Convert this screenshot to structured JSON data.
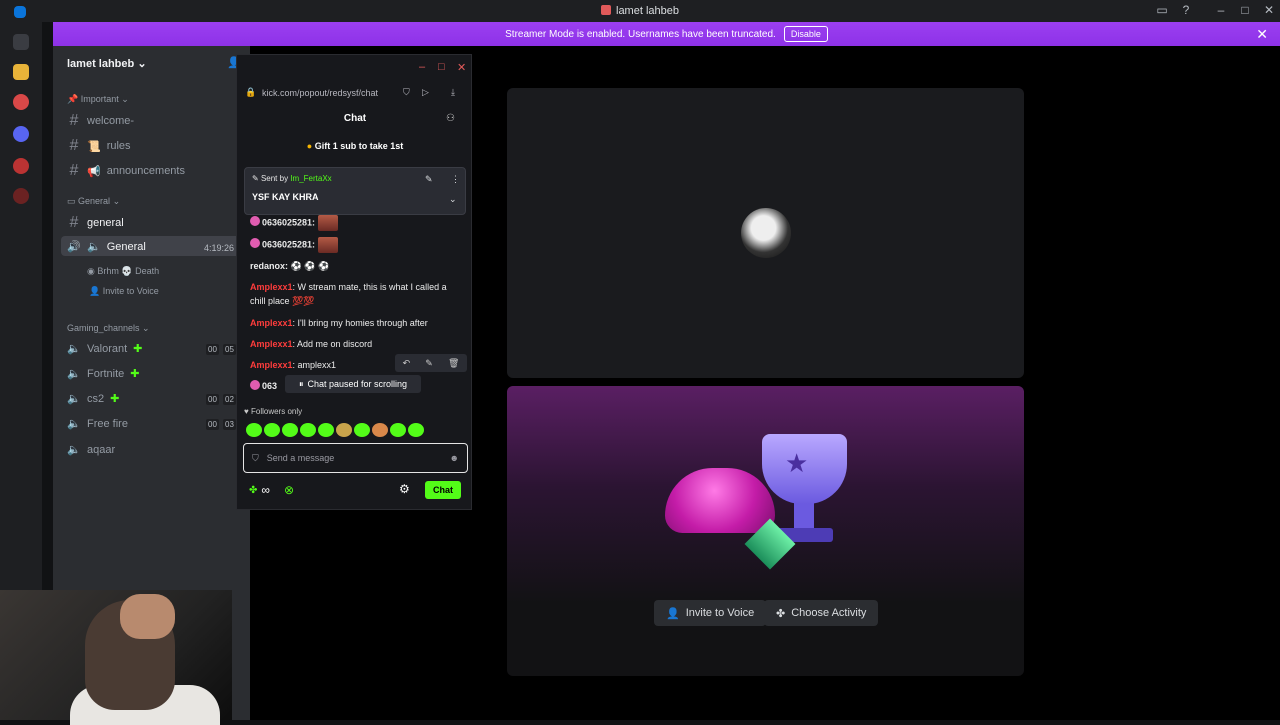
{
  "window": {
    "title": "lamet lahbeb"
  },
  "streamer_banner": {
    "text": "Streamer Mode is enabled. Usernames have been truncated.",
    "button": "Disable"
  },
  "sidebar": {
    "server_name": "lamet lahbeb",
    "categories": {
      "important": "Important",
      "general": "General",
      "gaming": "Gaming_channels"
    },
    "channels": {
      "welcome": "welcome-",
      "rules": "rules",
      "announcements": "announcements",
      "general_text": "general",
      "general_voice": "General",
      "general_voice_time": "4:19:26",
      "voice_user": "Brhm",
      "voice_user_status": "Death",
      "invite": "Invite to Voice",
      "valorant": "Valorant",
      "valorant_stamp_a": "00",
      "valorant_stamp_b": "05",
      "fortnite": "Fortnite",
      "cs2": "cs2",
      "cs2_stamp_a": "00",
      "cs2_stamp_b": "02",
      "freefire": "Free fire",
      "freefire_stamp_a": "00",
      "freefire_stamp_b": "03",
      "aqaar": "aqaar"
    }
  },
  "popup": {
    "url": "kick.com/popout/redsysf/chat",
    "header": "Chat",
    "gift": "Gift 1 sub to take 1st",
    "pinned": {
      "sent_by_label": "Sent by",
      "sent_by_user": "Im_FertaXx",
      "message": "YSF KAY KHRA"
    },
    "messages": [
      {
        "user": "0636025281:",
        "text": ""
      },
      {
        "user": "0636025281:",
        "text": ""
      },
      {
        "user": "redanox:",
        "text": "⚽ ⚽ ⚽"
      },
      {
        "user": "Amplexx1",
        "text": ": W stream mate, this is what I called a chill place 💯💯"
      },
      {
        "user": "Amplexx1",
        "text": ": I'll bring my homies through after"
      },
      {
        "user": "Amplexx1",
        "text": ": Add me on discord"
      },
      {
        "user": "Amplexx1",
        "text": ": amplexx1"
      },
      {
        "user": "063",
        "text": ""
      }
    ],
    "paused": "Chat paused for scrolling",
    "followers_only": "Followers only",
    "input_placeholder": "Send a message",
    "infinity": "∞",
    "chat_button": "Chat"
  },
  "stage": {
    "invite_button": "Invite to Voice",
    "activity_button": "Choose Activity"
  },
  "colors": {
    "kick_green": "#53fc18",
    "streamer_purple": "#9b3ff0",
    "username_red": "#ff3c3c"
  }
}
